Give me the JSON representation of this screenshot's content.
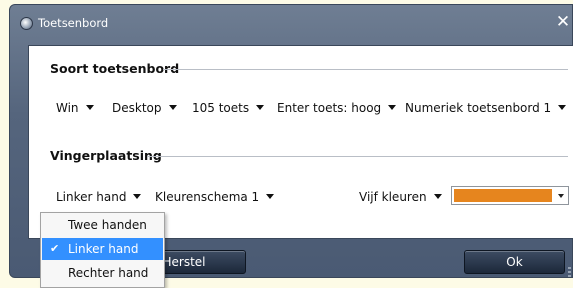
{
  "window": {
    "title": "Toetsenbord",
    "close_glyph": "✕"
  },
  "keyboard_section": {
    "title": "Soort toetsenbord",
    "dropdowns": [
      "Win",
      "Desktop",
      "105 toets",
      "Enter toets: hoog",
      "Numeriek toetsenbord 1"
    ]
  },
  "finger_section": {
    "title": "Vingerplaatsing",
    "hand_value": "Linker hand",
    "scheme_value": "Kleurenschema 1",
    "colors_value": "Vijf kleuren",
    "color_swatch": "#e6851e"
  },
  "buttons": {
    "reset": "Herstel",
    "ok": "Ok"
  },
  "hand_menu": {
    "items": [
      "Twee handen",
      "Linker hand",
      "Rechter hand"
    ],
    "selected_index": 1,
    "check_glyph": "✔"
  },
  "icons": {
    "window": "app-icon",
    "close": "close-icon",
    "dropdown": "caret-down-icon",
    "checkmark": "check-icon"
  },
  "colors": {
    "frame": "#55657d",
    "selection": "#3390ff",
    "panel": "#ffffff"
  }
}
